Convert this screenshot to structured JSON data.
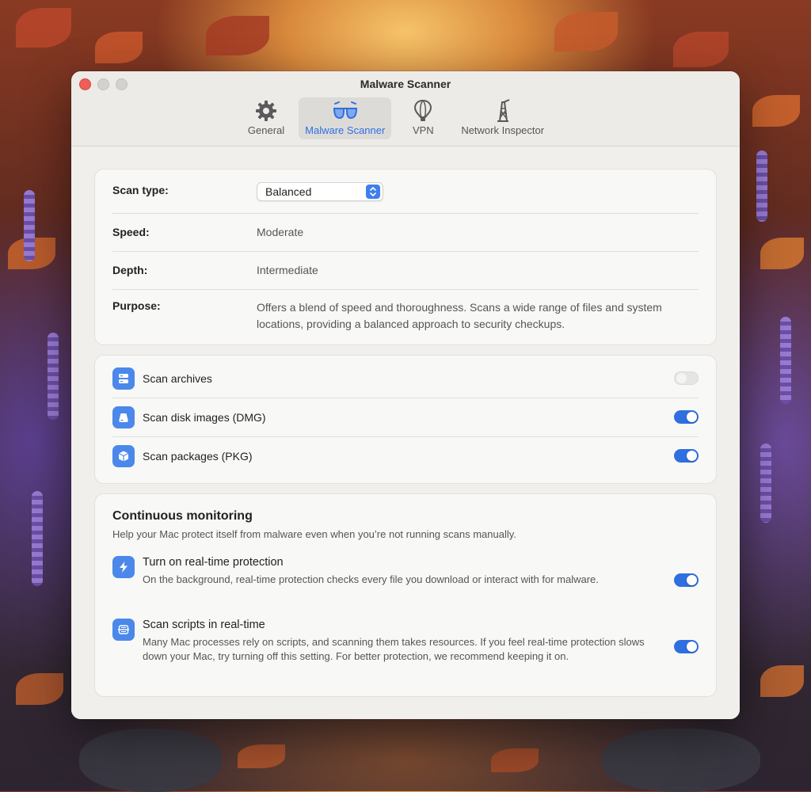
{
  "window": {
    "title": "Malware Scanner"
  },
  "toolbar": {
    "tabs": [
      {
        "label": "General",
        "icon": "gear-icon"
      },
      {
        "label": "Malware Scanner",
        "icon": "glasses-icon",
        "active": true
      },
      {
        "label": "VPN",
        "icon": "balloon-icon"
      },
      {
        "label": "Network Inspector",
        "icon": "tower-icon"
      }
    ]
  },
  "scan_info": {
    "type_label": "Scan type:",
    "type_value": "Balanced",
    "speed_label": "Speed:",
    "speed_value": "Moderate",
    "depth_label": "Depth:",
    "depth_value": "Intermediate",
    "purpose_label": "Purpose:",
    "purpose_value": "Offers a blend of speed and thoroughness. Scans a wide range of files and system locations, providing a balanced approach to security checkups."
  },
  "scan_options": [
    {
      "label": "Scan archives",
      "icon": "archive-icon",
      "enabled": false
    },
    {
      "label": "Scan disk images (DMG)",
      "icon": "disk-icon",
      "enabled": true
    },
    {
      "label": "Scan packages (PKG)",
      "icon": "package-icon",
      "enabled": true
    }
  ],
  "monitoring": {
    "title": "Continuous monitoring",
    "subtitle": "Help your Mac protect itself from malware even when you’re not running scans manually.",
    "items": [
      {
        "title": "Turn on real-time protection",
        "desc": "On the background, real-time protection checks every file you download or interact with for malware.",
        "icon": "bolt-icon",
        "enabled": true
      },
      {
        "title": "Scan scripts in real-time",
        "desc": "Many Mac processes rely on scripts, and scanning them takes resources. If you feel real-time protection slows down your Mac, try turning off this setting. For better protection, we recommend keeping it on.",
        "icon": "script-icon",
        "enabled": true
      }
    ]
  },
  "colors": {
    "accent": "#2f6fdf",
    "icon_bg": "#4b88ea",
    "close": "#ee5f57"
  }
}
